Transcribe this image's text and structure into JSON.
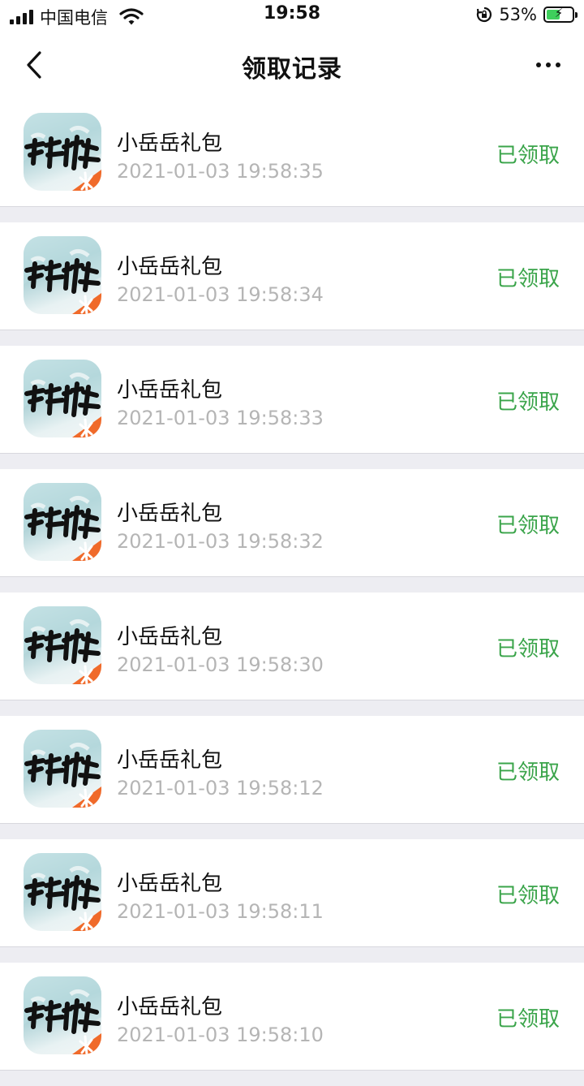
{
  "status_bar": {
    "carrier": "中国电信",
    "time": "19:58",
    "battery": "53%",
    "battery_level": 0.53
  },
  "nav": {
    "title": "领取记录",
    "back_icon": "chevron-left-icon",
    "more_icon": "ellipsis-icon"
  },
  "records": [
    {
      "name": "小岳岳礼包",
      "time": "2021-01-03 19:58:35",
      "status": "已领取"
    },
    {
      "name": "小岳岳礼包",
      "time": "2021-01-03 19:58:34",
      "status": "已领取"
    },
    {
      "name": "小岳岳礼包",
      "time": "2021-01-03 19:58:33",
      "status": "已领取"
    },
    {
      "name": "小岳岳礼包",
      "time": "2021-01-03 19:58:32",
      "status": "已领取"
    },
    {
      "name": "小岳岳礼包",
      "time": "2021-01-03 19:58:30",
      "status": "已领取"
    },
    {
      "name": "小岳岳礼包",
      "time": "2021-01-03 19:58:12",
      "status": "已领取"
    },
    {
      "name": "小岳岳礼包",
      "time": "2021-01-03 19:58:11",
      "status": "已领取"
    },
    {
      "name": "小岳岳礼包",
      "time": "2021-01-03 19:58:10",
      "status": "已领取"
    }
  ],
  "colors": {
    "status_green": "#3aa44a",
    "timestamp_gray": "#b5b5b5",
    "separator": "#ededf2"
  }
}
